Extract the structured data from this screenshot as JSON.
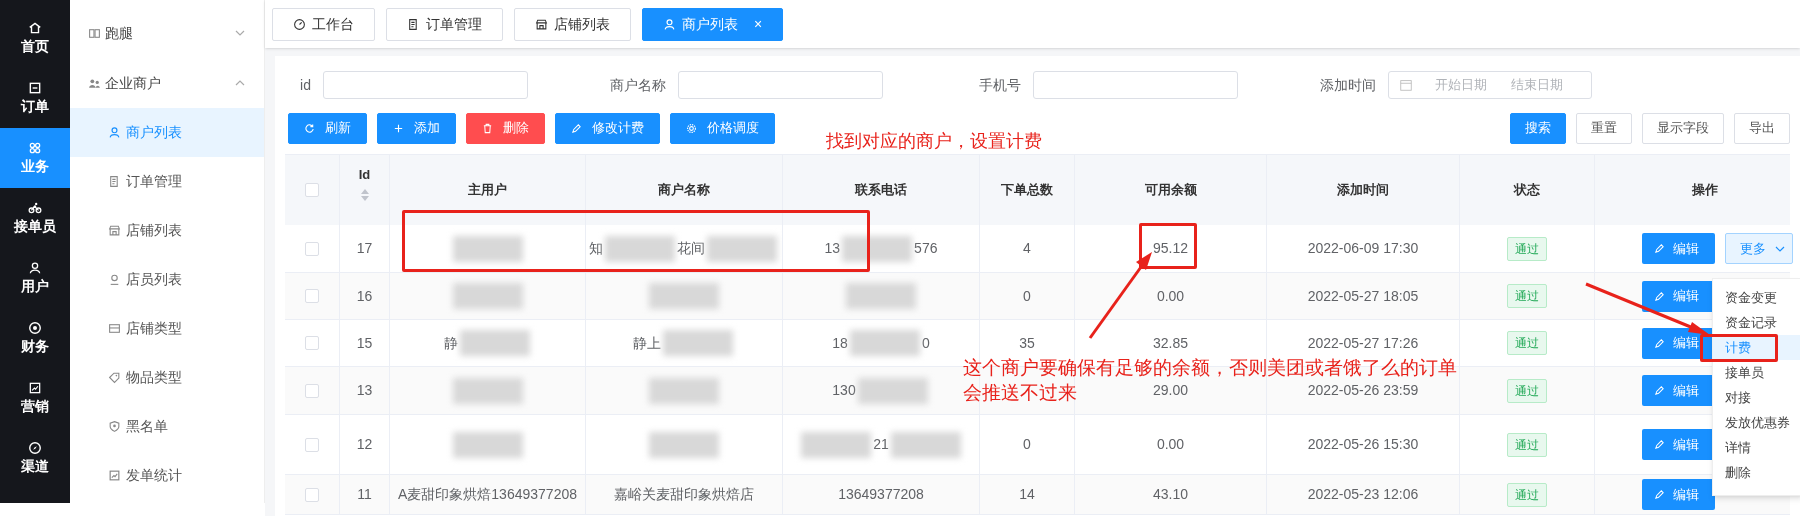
{
  "nav_rail": [
    {
      "label": "首页",
      "selected": false
    },
    {
      "label": "订单",
      "selected": false
    },
    {
      "label": "业务",
      "selected": true
    },
    {
      "label": "接单员",
      "selected": false
    },
    {
      "label": "用户",
      "selected": false
    },
    {
      "label": "财务",
      "selected": false
    },
    {
      "label": "营销",
      "selected": false
    },
    {
      "label": "渠道",
      "selected": false
    }
  ],
  "submenu": [
    {
      "label": "跑腿",
      "expanded": false
    },
    {
      "label": "企业商户",
      "expanded": true,
      "children": [
        {
          "label": "商户列表",
          "selected": true
        },
        {
          "label": "订单管理",
          "selected": false
        },
        {
          "label": "店铺列表",
          "selected": false
        },
        {
          "label": "店员列表",
          "selected": false
        },
        {
          "label": "店铺类型",
          "selected": false
        },
        {
          "label": "物品类型",
          "selected": false
        },
        {
          "label": "黑名单",
          "selected": false
        },
        {
          "label": "发单统计",
          "selected": false
        }
      ]
    }
  ],
  "tabs": [
    {
      "label": "工作台",
      "selected": false
    },
    {
      "label": "订单管理",
      "selected": false
    },
    {
      "label": "店铺列表",
      "selected": false
    },
    {
      "label": "商户列表",
      "selected": true,
      "close": "×"
    }
  ],
  "filters": [
    {
      "label": "id",
      "kind": "text"
    },
    {
      "label": "商户名称",
      "kind": "text"
    },
    {
      "label": "手机号",
      "kind": "text"
    },
    {
      "label": "添加时间",
      "kind": "daterange",
      "start_placeholder": "开始日期",
      "end_placeholder": "结束日期"
    }
  ],
  "toolbar_buttons": [
    {
      "label": "刷新",
      "kind": "primary"
    },
    {
      "label": "添加",
      "kind": "primary"
    },
    {
      "label": "删除",
      "kind": "danger"
    },
    {
      "label": "修改计费",
      "kind": "primary"
    },
    {
      "label": "价格调度",
      "kind": "primary"
    }
  ],
  "search_buttons": [
    {
      "label": "搜索",
      "kind": "primary"
    },
    {
      "label": "重置",
      "kind": "default"
    },
    {
      "label": "显示字段",
      "kind": "default"
    },
    {
      "label": "导出",
      "kind": "default"
    }
  ],
  "table": {
    "header_checked": false,
    "columns": [
      {
        "label": "Id",
        "sortable": true
      },
      {
        "label": "主用户",
        "sortable": false
      },
      {
        "label": "商户名称",
        "sortable": false
      },
      {
        "label": "联系电话",
        "sortable": false
      },
      {
        "label": "下单总数",
        "sortable": false
      },
      {
        "label": "可用余额",
        "sortable": false
      },
      {
        "label": "添加时间",
        "sortable": false
      },
      {
        "label": "状态",
        "sortable": false
      },
      {
        "label": "操作",
        "sortable": false
      }
    ],
    "rows": [
      {
        "checked": false,
        "id": "17",
        "main_user": [
          {
            "kind": "blur"
          }
        ],
        "merchant": [
          {
            "kind": "text",
            "text": "知"
          },
          {
            "kind": "blur"
          },
          {
            "kind": "text",
            "text": "花间"
          },
          {
            "kind": "blur"
          }
        ],
        "phone": [
          {
            "kind": "text",
            "text": "13"
          },
          {
            "kind": "blur"
          },
          {
            "kind": "text",
            "text": "576"
          }
        ],
        "orders": "4",
        "balance": "95.12",
        "time": "2022-06-09 17:30",
        "status": "通过",
        "edit": "编辑",
        "more": "更多"
      },
      {
        "checked": false,
        "id": "16",
        "main_user": [
          {
            "kind": "blur"
          }
        ],
        "merchant": [
          {
            "kind": "blur"
          }
        ],
        "phone": [
          {
            "kind": "blur"
          }
        ],
        "orders": "0",
        "balance": "0.00",
        "time": "2022-05-27 18:05",
        "status": "通过",
        "edit": "编辑"
      },
      {
        "checked": false,
        "id": "15",
        "main_user": [
          {
            "kind": "text",
            "text": "静"
          },
          {
            "kind": "blur"
          }
        ],
        "merchant": [
          {
            "kind": "text",
            "text": "静上"
          },
          {
            "kind": "blur"
          }
        ],
        "phone": [
          {
            "kind": "text",
            "text": "18"
          },
          {
            "kind": "blur"
          },
          {
            "kind": "text",
            "text": "0"
          }
        ],
        "orders": "35",
        "balance": "32.85",
        "time": "2022-05-27 17:26",
        "status": "通过",
        "edit": "编辑"
      },
      {
        "checked": false,
        "id": "13",
        "main_user": [
          {
            "kind": "blur"
          }
        ],
        "merchant": [
          {
            "kind": "blur"
          }
        ],
        "phone": [
          {
            "kind": "text",
            "text": "130"
          },
          {
            "kind": "blur"
          }
        ],
        "balance": "29.00",
        "time": "2022-05-26 23:59",
        "status": "通过",
        "edit": "编辑"
      },
      {
        "checked": false,
        "id": "12",
        "main_user": [
          {
            "kind": "blur"
          }
        ],
        "merchant": [
          {
            "kind": "blur"
          }
        ],
        "phone": [
          {
            "kind": "blur"
          },
          {
            "kind": "text",
            "text": "21"
          },
          {
            "kind": "blur"
          }
        ],
        "orders": "0",
        "balance": "0.00",
        "time": "2022-05-26 15:30",
        "status": "通过",
        "edit": "编辑"
      },
      {
        "checked": false,
        "id": "11",
        "main_user": [
          {
            "kind": "text",
            "text": "A麦甜印象烘焙13649377208"
          }
        ],
        "merchant": [
          {
            "kind": "text",
            "text": "嘉峪关麦甜印象烘焙店"
          }
        ],
        "phone": [
          {
            "kind": "text",
            "text": "13649377208"
          }
        ],
        "orders": "14",
        "balance": "43.10",
        "time": "2022-05-23 12:06",
        "status": "通过",
        "edit": "编辑"
      }
    ]
  },
  "more_menu": [
    {
      "label": "资金变更",
      "selected": false
    },
    {
      "label": "资金记录",
      "selected": false
    },
    {
      "label": "计费",
      "selected": true
    },
    {
      "label": "接单员",
      "selected": false
    },
    {
      "label": "对接",
      "selected": false
    },
    {
      "label": "发放优惠券",
      "selected": false
    },
    {
      "label": "详情",
      "selected": false
    },
    {
      "label": "删除",
      "selected": false
    }
  ],
  "annotations": [
    {
      "kind": "note",
      "text": "找到对应的商户，设置计费"
    },
    {
      "kind": "note",
      "text": "这个商户要确保有足够的余额，否则美团或者饿了么的订单"
    },
    {
      "kind": "note",
      "text": "会推送不过来"
    }
  ]
}
